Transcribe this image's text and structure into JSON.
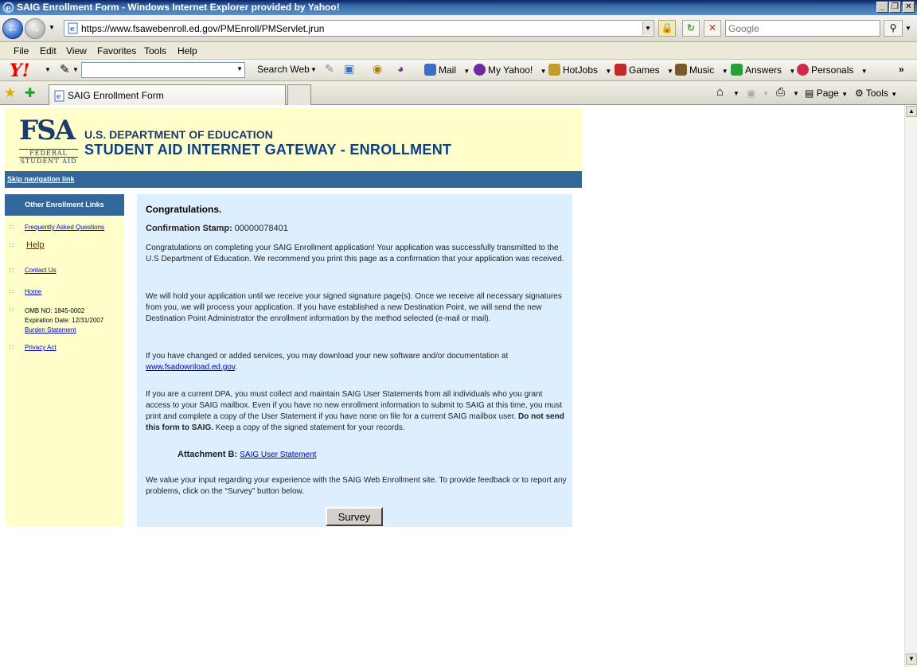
{
  "window": {
    "title": "SAIG Enrollment Form - Windows Internet Explorer provided by Yahoo!",
    "min_glyph": "_",
    "max_glyph": "❐",
    "close_glyph": "✕"
  },
  "address_bar": {
    "url": "https://www.fsawebenroll.ed.gov/PMEnroll/PMServlet.jrun"
  },
  "search_box": {
    "placeholder": "Google"
  },
  "menu": [
    "File",
    "Edit",
    "View",
    "Favorites",
    "Tools",
    "Help"
  ],
  "yahoo_toolbar": {
    "logo": "Y!",
    "search_button": "Search Web",
    "items": [
      "Mail",
      "My Yahoo!",
      "HotJobs",
      "Games",
      "Music",
      "Answers",
      "Personals"
    ],
    "icon_colors": [
      "#3a6fc7",
      "#6b2a9e",
      "#c29b2a",
      "#c02a2a",
      "#7a5a2a",
      "#2a9e3a",
      "#d02a4a"
    ]
  },
  "tabs": {
    "active_label": "SAIG Enrollment Form"
  },
  "command_bar": {
    "page": "Page",
    "tools": "Tools"
  },
  "page": {
    "dept": "U.S. DEPARTMENT OF EDUCATION",
    "gateway": "STUDENT AID INTERNET GATEWAY - ENROLLMENT",
    "logo_letters": "FSA",
    "logo_sub_1": "FEDERAL",
    "logo_sub_2": "STUDENT AID",
    "skip_link": "Skip navigation link"
  },
  "sidebar": {
    "heading": "Other Enrollment Links",
    "faq": "Frequently Asked Questions",
    "help": "Help",
    "contact": "Contact Us",
    "home": "Home",
    "omb": "OMB NO: 1845-0002",
    "expiration": "Expiration Date: 12/31/2007",
    "burden": "Burden Statement",
    "privacy": "Privacy Act"
  },
  "main": {
    "congrats": "Congratulations.",
    "stamp_label": "Confirmation Stamp:",
    "stamp_value": "00000078401",
    "para1": "Congratulations on completing your SAIG Enrollment application! Your application was successfully transmitted to the U.S Department of Education. We recommend you print this page as a confirmation that your application was received.",
    "para2": "We will hold your application until we receive your signed signature page(s). Once we receive all necessary signatures from you, we will process your application. If you have established a new Destination Point, we will send the new Destination Point Administrator the enrollment information by the method selected (e-mail or mail).",
    "para3": "If you have changed or added services, you may download your new software and/or documentation at",
    "download_link": "www.fsadownload.ed.gov",
    "para4_start": "If you are a current DPA, you must collect and maintain SAIG User Statements from all individuals who you grant access to your SAIG mailbox. Even if you have no new enrollment information to submit to SAIG at this time, you must print and complete a copy of the User Statement if you have none on file for a current SAIG mailbox user.",
    "para4_bold": "Do not send this form to SAIG.",
    "para4_end": "Keep a copy of the signed statement for your records.",
    "attachment_label": "Attachment B:",
    "attachment_link": "SAIG User Statement",
    "para5": "We value your input regarding your experience with the SAIG Web Enrollment site. To provide feedback or to report any problems, click on the “Survey” button below.",
    "survey_button": "Survey"
  }
}
